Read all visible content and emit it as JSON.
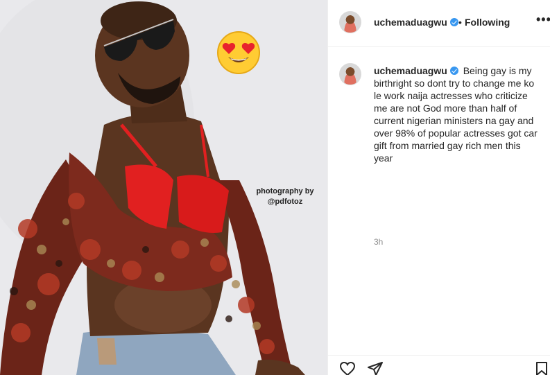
{
  "photo": {
    "credit_line1": "photography by",
    "credit_line2": "@pdfotoz",
    "emoji": "heart-eyes-emoji"
  },
  "header": {
    "username": "uchemaduagwu",
    "verified": true,
    "separator": "•",
    "follow_status": "Following",
    "more_label": "•••"
  },
  "caption": {
    "username": "uchemaduagwu",
    "text": "Being gay is my birthright so dont try to change me ko le work naija actresses who criticize me are not God more than half of current nigerian ministers na gay and over 98% of popular actresses got car gift from married gay rich men this year",
    "time": "3h"
  },
  "actions": {
    "icons": [
      "heart-icon",
      "share-icon",
      "bookmark-icon"
    ]
  },
  "colors": {
    "verified": "#3897f0",
    "text": "#262626",
    "muted": "#8e8e8e",
    "border": "#efefef"
  }
}
